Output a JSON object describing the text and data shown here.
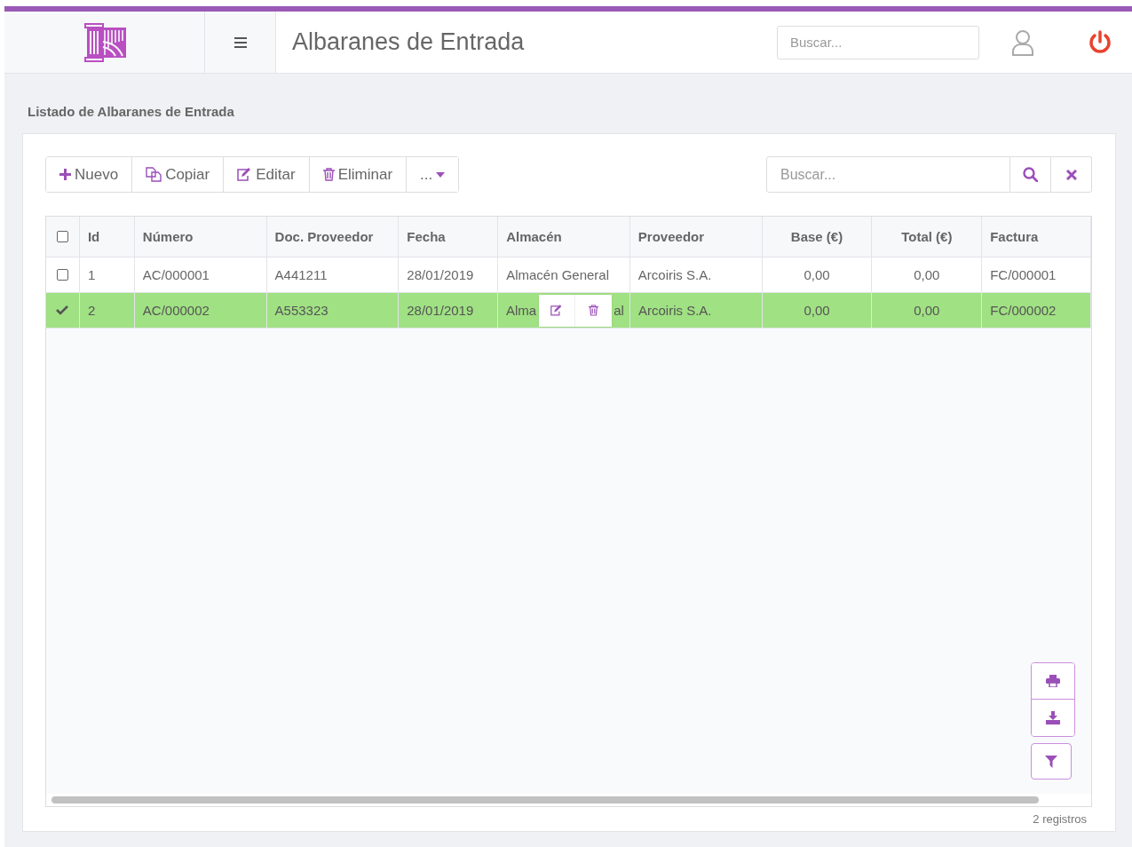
{
  "header": {
    "title": "Albaranes de Entrada",
    "search": {
      "placeholder": "Buscar..."
    }
  },
  "section_title": "Listado de Albaranes de Entrada",
  "toolbar": [
    {
      "kind": "plus",
      "label": "Nuevo"
    },
    {
      "kind": "copy",
      "label": "Copiar"
    },
    {
      "kind": "edit",
      "label": "Editar"
    },
    {
      "kind": "trash",
      "label": "Eliminar"
    },
    {
      "kind": "more",
      "label": "..."
    }
  ],
  "table_search": {
    "placeholder": "Buscar..."
  },
  "table": {
    "select_all": {
      "checked": false
    },
    "columns": [
      {
        "label": "Id"
      },
      {
        "label": "Número"
      },
      {
        "label": "Doc. Proveedor"
      },
      {
        "label": "Fecha"
      },
      {
        "label": "Almacén"
      },
      {
        "label": "Proveedor"
      },
      {
        "label": "Base (€)"
      },
      {
        "label": "Total (€)"
      },
      {
        "label": "Factura"
      }
    ],
    "rows": [
      {
        "selected": false,
        "hover_actions": false,
        "cells": [
          "1",
          "AC/000001",
          "A441211",
          "28/01/2019",
          "Almacén General",
          "Arcoiris S.A.",
          "0,00",
          "0,00",
          "FC/000001"
        ]
      },
      {
        "selected": true,
        "hover_actions": true,
        "hidden_tail": "al",
        "cells": [
          "2",
          "AC/000002",
          "A553323",
          "28/01/2019",
          "Alma",
          "Arcoiris S.A.",
          "0,00",
          "0,00",
          "FC/000002"
        ]
      }
    ]
  },
  "footer": "2 registros"
}
